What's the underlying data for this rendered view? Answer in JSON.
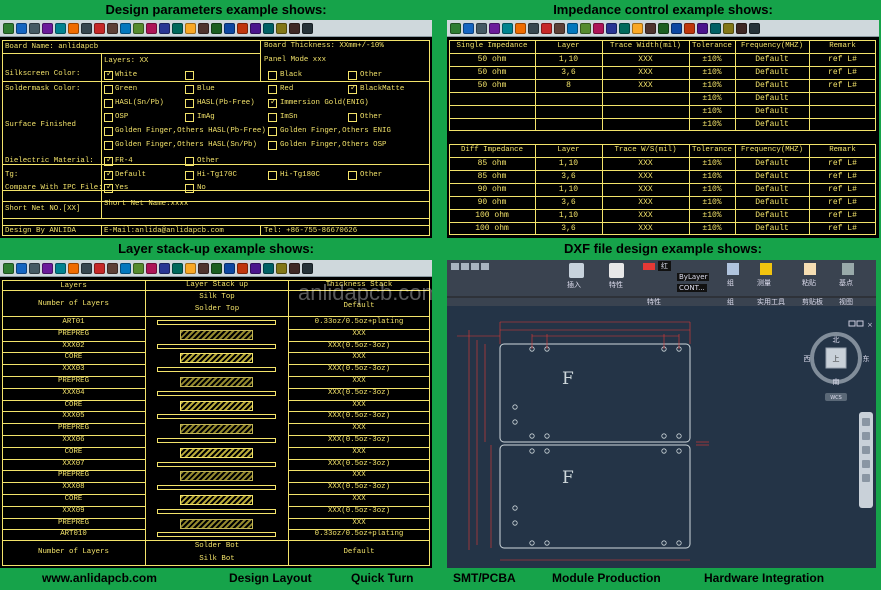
{
  "titles": {
    "design": "Design parameters example shows:",
    "impedance": "Impedance control example shows:",
    "stackup": "Layer stack-up example shows:",
    "dxf": "DXF file design example shows:"
  },
  "toolbar_icons": [
    "new-file-icon",
    "open-folder-icon",
    "save-icon",
    "print-icon",
    "zoom-in-icon",
    "zoom-out-icon",
    "zoom-window-icon",
    "pan-icon",
    "redraw-icon",
    "layer-icon",
    "grid-icon",
    "measure-icon",
    "line-icon",
    "arc-icon",
    "polygon-icon",
    "text-icon",
    "drill-icon",
    "pad-icon",
    "via-icon",
    "trace-icon",
    "copper-icon",
    "check-icon",
    "settings-icon",
    "help-icon"
  ],
  "design_params": {
    "board_name": "Board Name: anlidapcb",
    "board_thickness": "Board Thickness: XXmm+/-10%",
    "layers": "Layers: XX",
    "panel_mode": "Panel Mode xxx",
    "silkscreen_color": "Silkscreen Color:",
    "soldermask_color": "Soldermask Color:",
    "surface_finished": "Surface Finished",
    "dielectric_material": "Dielectric Material:",
    "tg": "Tg:",
    "compare_ipc": "Compare With IPC File:",
    "short_net_no": "Short Net NO.[XX]",
    "short_net_name": "Short Net Name:xxxx",
    "design_by": "Design By ANLIDA",
    "email": "E-Mail:anlida@anlidapcb.com",
    "tel": "Tel: +86-755-86670626",
    "opt_white": "White",
    "opt_black": "Black",
    "opt_other": "Other",
    "opt_green": "Green",
    "opt_blue": "Blue",
    "opt_red": "Red",
    "opt_blackmatte": "BlackMatte",
    "opt_hasl_pb": "HASL(Sn/Pb)",
    "opt_hasl_pbfree": "HASL(Pb-Free)",
    "opt_immersion_gold": "Immersion Gold(ENIG)",
    "opt_osp": "OSP",
    "opt_imag": "ImAg",
    "opt_imsn": "ImSn",
    "opt_gf_hasl_pbfree": "Golden Finger,Others HASL(Pb-Free)",
    "opt_gf_enig": "Golden Finger,Others ENIG",
    "opt_gf_hasl_snpb": "Golden Finger,Others HASL(Sn/Pb)",
    "opt_gf_osp": "Golden Finger,Others OSP",
    "opt_fr4": "FR-4",
    "opt_default": "Default",
    "opt_hitg170": "Hi-Tg170C",
    "opt_hitg180": "Hi-Tg180C",
    "opt_yes": "Yes",
    "opt_no": "No"
  },
  "impedance": {
    "single_headers": [
      "Single Impedance",
      "Layer",
      "Trace Width(mil)",
      "Tolerance",
      "Frequency(MHZ)",
      "Remark"
    ],
    "single_rows": [
      [
        "50 ohm",
        "1,10",
        "XXX",
        "±10%",
        "Default",
        "ref L#"
      ],
      [
        "50 ohm",
        "3,6",
        "XXX",
        "±10%",
        "Default",
        "ref L#"
      ],
      [
        "50 ohm",
        "8",
        "XXX",
        "±10%",
        "Default",
        "ref L#"
      ],
      [
        "",
        "",
        "",
        "±10%",
        "Default",
        ""
      ],
      [
        "",
        "",
        "",
        "±10%",
        "Default",
        ""
      ],
      [
        "",
        "",
        "",
        "±10%",
        "Default",
        ""
      ]
    ],
    "diff_headers": [
      "Diff Impedance",
      "Layer",
      "Trace W/S(mil)",
      "Tolerance",
      "Frequency(MHZ)",
      "Remark"
    ],
    "diff_rows": [
      [
        "85 ohm",
        "1,10",
        "XXX",
        "±10%",
        "Default",
        "ref L#"
      ],
      [
        "85 ohm",
        "3,6",
        "XXX",
        "±10%",
        "Default",
        "ref L#"
      ],
      [
        "90 ohm",
        "1,10",
        "XXX",
        "±10%",
        "Default",
        "ref L#"
      ],
      [
        "90 ohm",
        "3,6",
        "XXX",
        "±10%",
        "Default",
        "ref L#"
      ],
      [
        "100 ohm",
        "1,10",
        "XXX",
        "±10%",
        "Default",
        "ref L#"
      ],
      [
        "100 ohm",
        "3,6",
        "XXX",
        "±10%",
        "Default",
        "ref L#"
      ]
    ]
  },
  "stackup": {
    "header_layers": "Layers",
    "header_stack": "Layer Stack up",
    "header_thickness": "Thickness Stack",
    "number_of_layers": "Number of Layers",
    "silk_top": "Silk Top",
    "solder_top": "Solder Top",
    "default": "Default",
    "watermark": "anlidapcb.com",
    "rows": [
      {
        "name": "ART01",
        "thick": "0.33oz/0.5oz+plating",
        "kind": "copper"
      },
      {
        "name": "PREPREG",
        "thick": "XXX",
        "kind": "prepreg"
      },
      {
        "name": "XXX02",
        "thick": "XXX(0.5oz-3oz)",
        "kind": "copper"
      },
      {
        "name": "CORE",
        "thick": "XXX",
        "kind": "core"
      },
      {
        "name": "XXX03",
        "thick": "XXX(0.5oz-3oz)",
        "kind": "copper"
      },
      {
        "name": "PREPREG",
        "thick": "XXX",
        "kind": "prepreg"
      },
      {
        "name": "XXX04",
        "thick": "XXX(0.5oz-3oz)",
        "kind": "copper"
      },
      {
        "name": "CORE",
        "thick": "XXX",
        "kind": "core"
      },
      {
        "name": "XXX05",
        "thick": "XXX(0.5oz-3oz)",
        "kind": "copper"
      },
      {
        "name": "PREPREG",
        "thick": "XXX",
        "kind": "prepreg"
      },
      {
        "name": "XXX06",
        "thick": "XXX(0.5oz-3oz)",
        "kind": "copper"
      },
      {
        "name": "CORE",
        "thick": "XXX",
        "kind": "core"
      },
      {
        "name": "XXX07",
        "thick": "XXX(0.5oz-3oz)",
        "kind": "copper"
      },
      {
        "name": "PREPREG",
        "thick": "XXX",
        "kind": "prepreg"
      },
      {
        "name": "XXX08",
        "thick": "XXX(0.5oz-3oz)",
        "kind": "copper"
      },
      {
        "name": "CORE",
        "thick": "XXX",
        "kind": "core"
      },
      {
        "name": "XXX09",
        "thick": "XXX(0.5oz-3oz)",
        "kind": "copper"
      },
      {
        "name": "PREPREG",
        "thick": "XXX",
        "kind": "prepreg"
      },
      {
        "name": "ART010",
        "thick": "0.33oz/0.5oz+plating",
        "kind": "copper"
      }
    ],
    "solder_bot": "Solder Bot",
    "silk_bot": "Silk Bot"
  },
  "dxf": {
    "insert_label": "插入",
    "properties_label": "特性",
    "match_label": "特性\n匹配",
    "layer_value": "ByLayer",
    "linetype_value": "CONT...",
    "color_value": "红",
    "group_label": "组",
    "measure_label": "测量",
    "paste_label": "粘贴",
    "base_label": "基点",
    "panel_props": "特性",
    "panel_group": "组",
    "panel_utils": "实用工具",
    "panel_clipboard": "剪贴板",
    "panel_view": "视图",
    "compass_n": "北",
    "compass_s": "南",
    "compass_e": "东",
    "compass_w": "西",
    "compass_top": "上",
    "wcs_label": "WCS",
    "board_mark_top": "F",
    "board_mark_bottom": "F"
  },
  "footer": [
    "www.anlidapcb.com",
    "Design Layout",
    "Quick Turn",
    "SMT/PCBA",
    "Module Production",
    "Hardware Integration"
  ],
  "colors": {
    "background": "#16a34a",
    "cad_yellow": "#f3e36a",
    "cad_red": "#e53935",
    "canvas": "#000000"
  }
}
